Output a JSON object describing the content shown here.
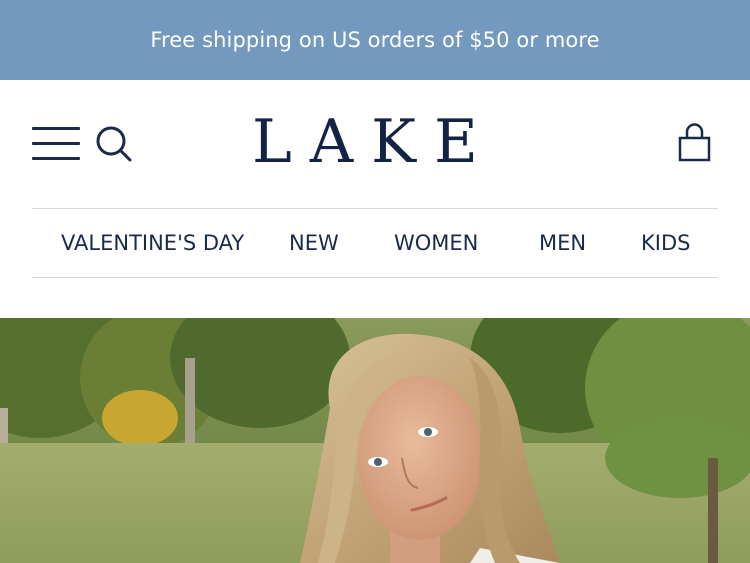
{
  "promo": {
    "text": "Free shipping on US orders of $50 or more"
  },
  "header": {
    "logo_text": "LAKE",
    "icons": {
      "menu": "hamburger-menu-icon",
      "search": "search-icon",
      "cart": "shopping-bag-icon"
    }
  },
  "nav": {
    "items": [
      {
        "label": "VALENTINE'S DAY"
      },
      {
        "label": "NEW"
      },
      {
        "label": "WOMEN"
      },
      {
        "label": "MEN"
      },
      {
        "label": "KIDS"
      }
    ]
  },
  "colors": {
    "promo_bg": "#7399bf",
    "brand_navy": "#142246",
    "nav_text": "#1c2a4a",
    "divider": "#d7d7d7"
  },
  "hero": {
    "image": "woman-outdoors-hero-photo"
  }
}
